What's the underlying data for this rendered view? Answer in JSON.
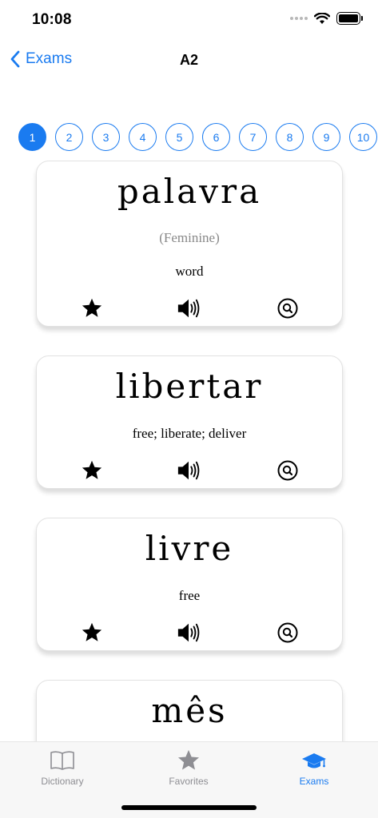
{
  "status": {
    "time": "10:08"
  },
  "nav": {
    "back_label": "Exams",
    "title": "A2"
  },
  "pager": {
    "pages": [
      "1",
      "2",
      "3",
      "4",
      "5",
      "6",
      "7",
      "8",
      "9",
      "10"
    ],
    "active_index": 0
  },
  "cards": [
    {
      "word": "palavra",
      "gender": "(Feminine)",
      "meaning": "word"
    },
    {
      "word": "libertar",
      "gender": "",
      "meaning": "free; liberate; deliver"
    },
    {
      "word": "livre",
      "gender": "",
      "meaning": "free"
    },
    {
      "word": "mês",
      "gender": "",
      "meaning": ""
    }
  ],
  "tabs": [
    {
      "label": "Dictionary",
      "icon": "book-icon"
    },
    {
      "label": "Favorites",
      "icon": "star-icon"
    },
    {
      "label": "Exams",
      "icon": "graduation-cap-icon"
    }
  ],
  "colors": {
    "accent": "#1a7bf0",
    "tab_inactive": "#8e8e93"
  }
}
